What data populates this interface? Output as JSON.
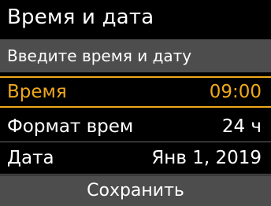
{
  "title": "Время и дата",
  "subtitle": "Введите время и дату",
  "rows": [
    {
      "label": "Время",
      "value": "09:00"
    },
    {
      "label": "Формат врем",
      "value": "24 ч"
    },
    {
      "label": "Дата",
      "value": "Янв 1, 2019"
    }
  ],
  "save_label": "Сохранить",
  "colors": {
    "accent": "#f0a81c",
    "background": "#000000",
    "bar": "#4d4d4d"
  }
}
